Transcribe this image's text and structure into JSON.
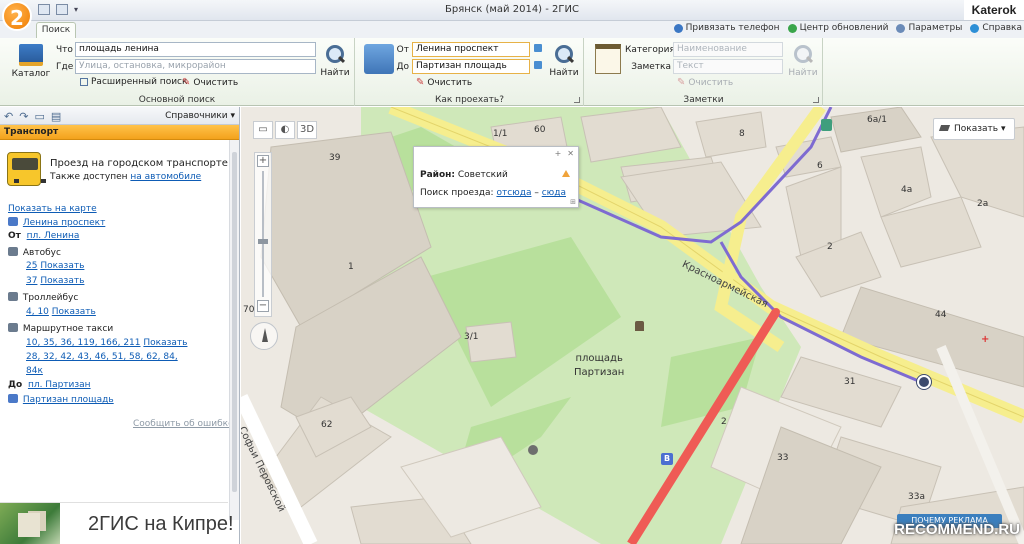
{
  "app": {
    "logo_text": "2",
    "window_title": "Брянск (май 2014) - 2ГИС",
    "user_badge": "Katerok"
  },
  "tabs": {
    "search": "Поиск"
  },
  "toplinks": [
    {
      "label": "Привязать телефон",
      "icon": "phone-icon",
      "color": "#3b77c4"
    },
    {
      "label": "Центр обновлений",
      "icon": "refresh-icon",
      "color": "#3aa54a"
    },
    {
      "label": "Параметры",
      "icon": "settings-icon",
      "color": "#6b8bb8"
    },
    {
      "label": "Справка",
      "icon": "help-icon",
      "color": "#2d8fd6"
    }
  ],
  "ribbon": {
    "basic_search": {
      "catalog": "Каталог",
      "what_label": "Что",
      "what_value": "площадь ленина",
      "where_label": "Где",
      "where_placeholder": "Улица, остановка, микрорайон",
      "find": "Найти",
      "advanced": "Расширенный поиск",
      "clear": "Очистить",
      "group_label": "Основной поиск"
    },
    "route": {
      "from_label": "От",
      "from_value": "Ленина проспект",
      "to_label": "До",
      "to_value": "Партизан площадь",
      "find": "Найти",
      "clear": "Очистить",
      "group_label": "Как проехать?"
    },
    "notes": {
      "category_label": "Категория",
      "category_placeholder": "Наименование",
      "note_label": "Заметка",
      "note_placeholder": "Текст",
      "find": "Найти",
      "clear": "Очистить",
      "group_label": "Заметки"
    }
  },
  "left_panel": {
    "directories": "Справочники",
    "header": "Транспорт",
    "title": "Проезд на городском транспорте",
    "also_prefix": "Также доступен",
    "also_link": "на автомобиле",
    "show_on_map": "Показать на карте",
    "start_stop": "Ленина проспект",
    "from_label": "От",
    "from_link": "пл. Ленина",
    "bus_label": "Автобус",
    "bus_routes_1": "25",
    "bus_routes_2": "37",
    "show": "Показать",
    "trolley_label": "Троллейбус",
    "trolley_routes": "4, 10",
    "taxi_label": "Маршрутное такси",
    "taxi_line1": "10, 35, 36, 119, 166, 211",
    "taxi_line2": "28, 32, 42, 43, 46, 51, 58, 62, 84,",
    "taxi_line3": "84к",
    "to_label": "До",
    "to_link": "пл. Партизан",
    "end_stop": "Партизан площадь",
    "report_error": "Сообщить об ошибке",
    "ad_text": "2ГИС на Кипре!"
  },
  "map": {
    "mode_3d": "3D",
    "show_button": "Показать",
    "popup": {
      "district_label": "Район:",
      "district_value": "Советский",
      "route_label": "Поиск проезда:",
      "route_from": "отсюда",
      "dash": "–",
      "route_to": "сюда"
    },
    "square_name": "площадь\nПартизан",
    "streets": {
      "krasnoarm": "Красноармейская",
      "sofii": "Софьи Перовской"
    },
    "house_numbers": [
      "39",
      "1/1",
      "60",
      "6а/1",
      "8",
      "6",
      "4а",
      "2а",
      "2",
      "1",
      "3/1",
      "44",
      "31",
      "2",
      "33",
      "33а",
      "62",
      "70"
    ],
    "ad_why": "ПОЧЕМУ РЕКЛАМА",
    "watermark": "RECOMMEND.RU",
    "colors": {
      "road": "#f6ee8e",
      "route_bus": "#7e6bd1",
      "route_walk": "#ef5b55",
      "park": "#cfe8b9",
      "park_dark": "#a9d68b",
      "building": "#e2dbd0"
    }
  }
}
